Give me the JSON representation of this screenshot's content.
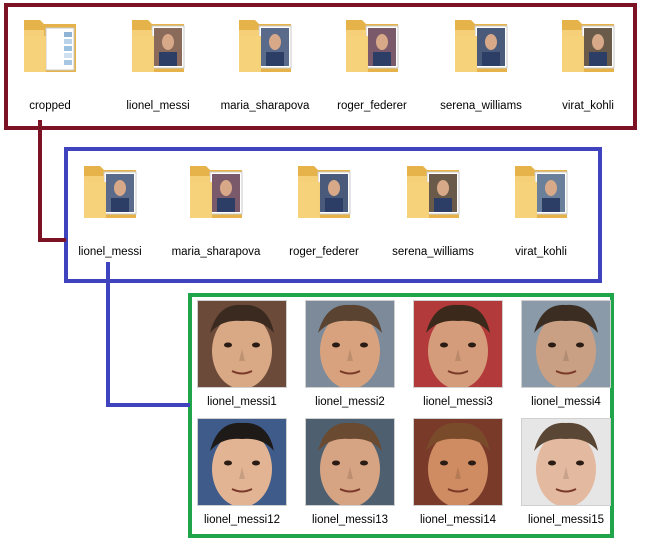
{
  "colors": {
    "top_group": "#7b1325",
    "cropped_group": "#3f44be",
    "images_group": "#21a54a",
    "folder": "#f5d27a",
    "folder_dark": "#e6b34a"
  },
  "top_group": {
    "folders": [
      {
        "label": "cropped",
        "icon": "folder-icon",
        "preview": "documents"
      },
      {
        "label": "lionel_messi",
        "icon": "folder-icon",
        "preview": "photos"
      },
      {
        "label": "maria_sharapova",
        "icon": "folder-icon",
        "preview": "photos"
      },
      {
        "label": "roger_federer",
        "icon": "folder-icon",
        "preview": "photos"
      },
      {
        "label": "serena_williams",
        "icon": "folder-icon",
        "preview": "photos"
      },
      {
        "label": "virat_kohli",
        "icon": "folder-icon",
        "preview": "photos"
      }
    ]
  },
  "cropped_group": {
    "folders": [
      {
        "label": "lionel_messi",
        "icon": "folder-icon"
      },
      {
        "label": "maria_sharapova",
        "icon": "folder-icon"
      },
      {
        "label": "roger_federer",
        "icon": "folder-icon"
      },
      {
        "label": "serena_williams",
        "icon": "folder-icon"
      },
      {
        "label": "virat_kohli",
        "icon": "folder-icon"
      }
    ]
  },
  "images_group": {
    "images": [
      {
        "label": "lionel_messi1",
        "skin": "#d9a884",
        "hair": "#3a2a1f",
        "bg": "#6b4a3a"
      },
      {
        "label": "lionel_messi2",
        "skin": "#d7a27d",
        "hair": "#5a4330",
        "bg": "#7c8a9a"
      },
      {
        "label": "lionel_messi3",
        "skin": "#d49c7a",
        "hair": "#3b2a1c",
        "bg": "#b23a3a"
      },
      {
        "label": "lionel_messi4",
        "skin": "#caa084",
        "hair": "#3b2d22",
        "bg": "#8a9aa8"
      },
      {
        "label": "lionel_messi12",
        "skin": "#e2b494",
        "hair": "#1e1a18",
        "bg": "#3e5b8a"
      },
      {
        "label": "lionel_messi13",
        "skin": "#d6a383",
        "hair": "#6a4a30",
        "bg": "#4e6070"
      },
      {
        "label": "lionel_messi14",
        "skin": "#cf8b62",
        "hair": "#7a4b2a",
        "bg": "#7a3a2a"
      },
      {
        "label": "lionel_messi15",
        "skin": "#e3b9a0",
        "hair": "#5a4635",
        "bg": "#e6e6e6"
      }
    ]
  }
}
